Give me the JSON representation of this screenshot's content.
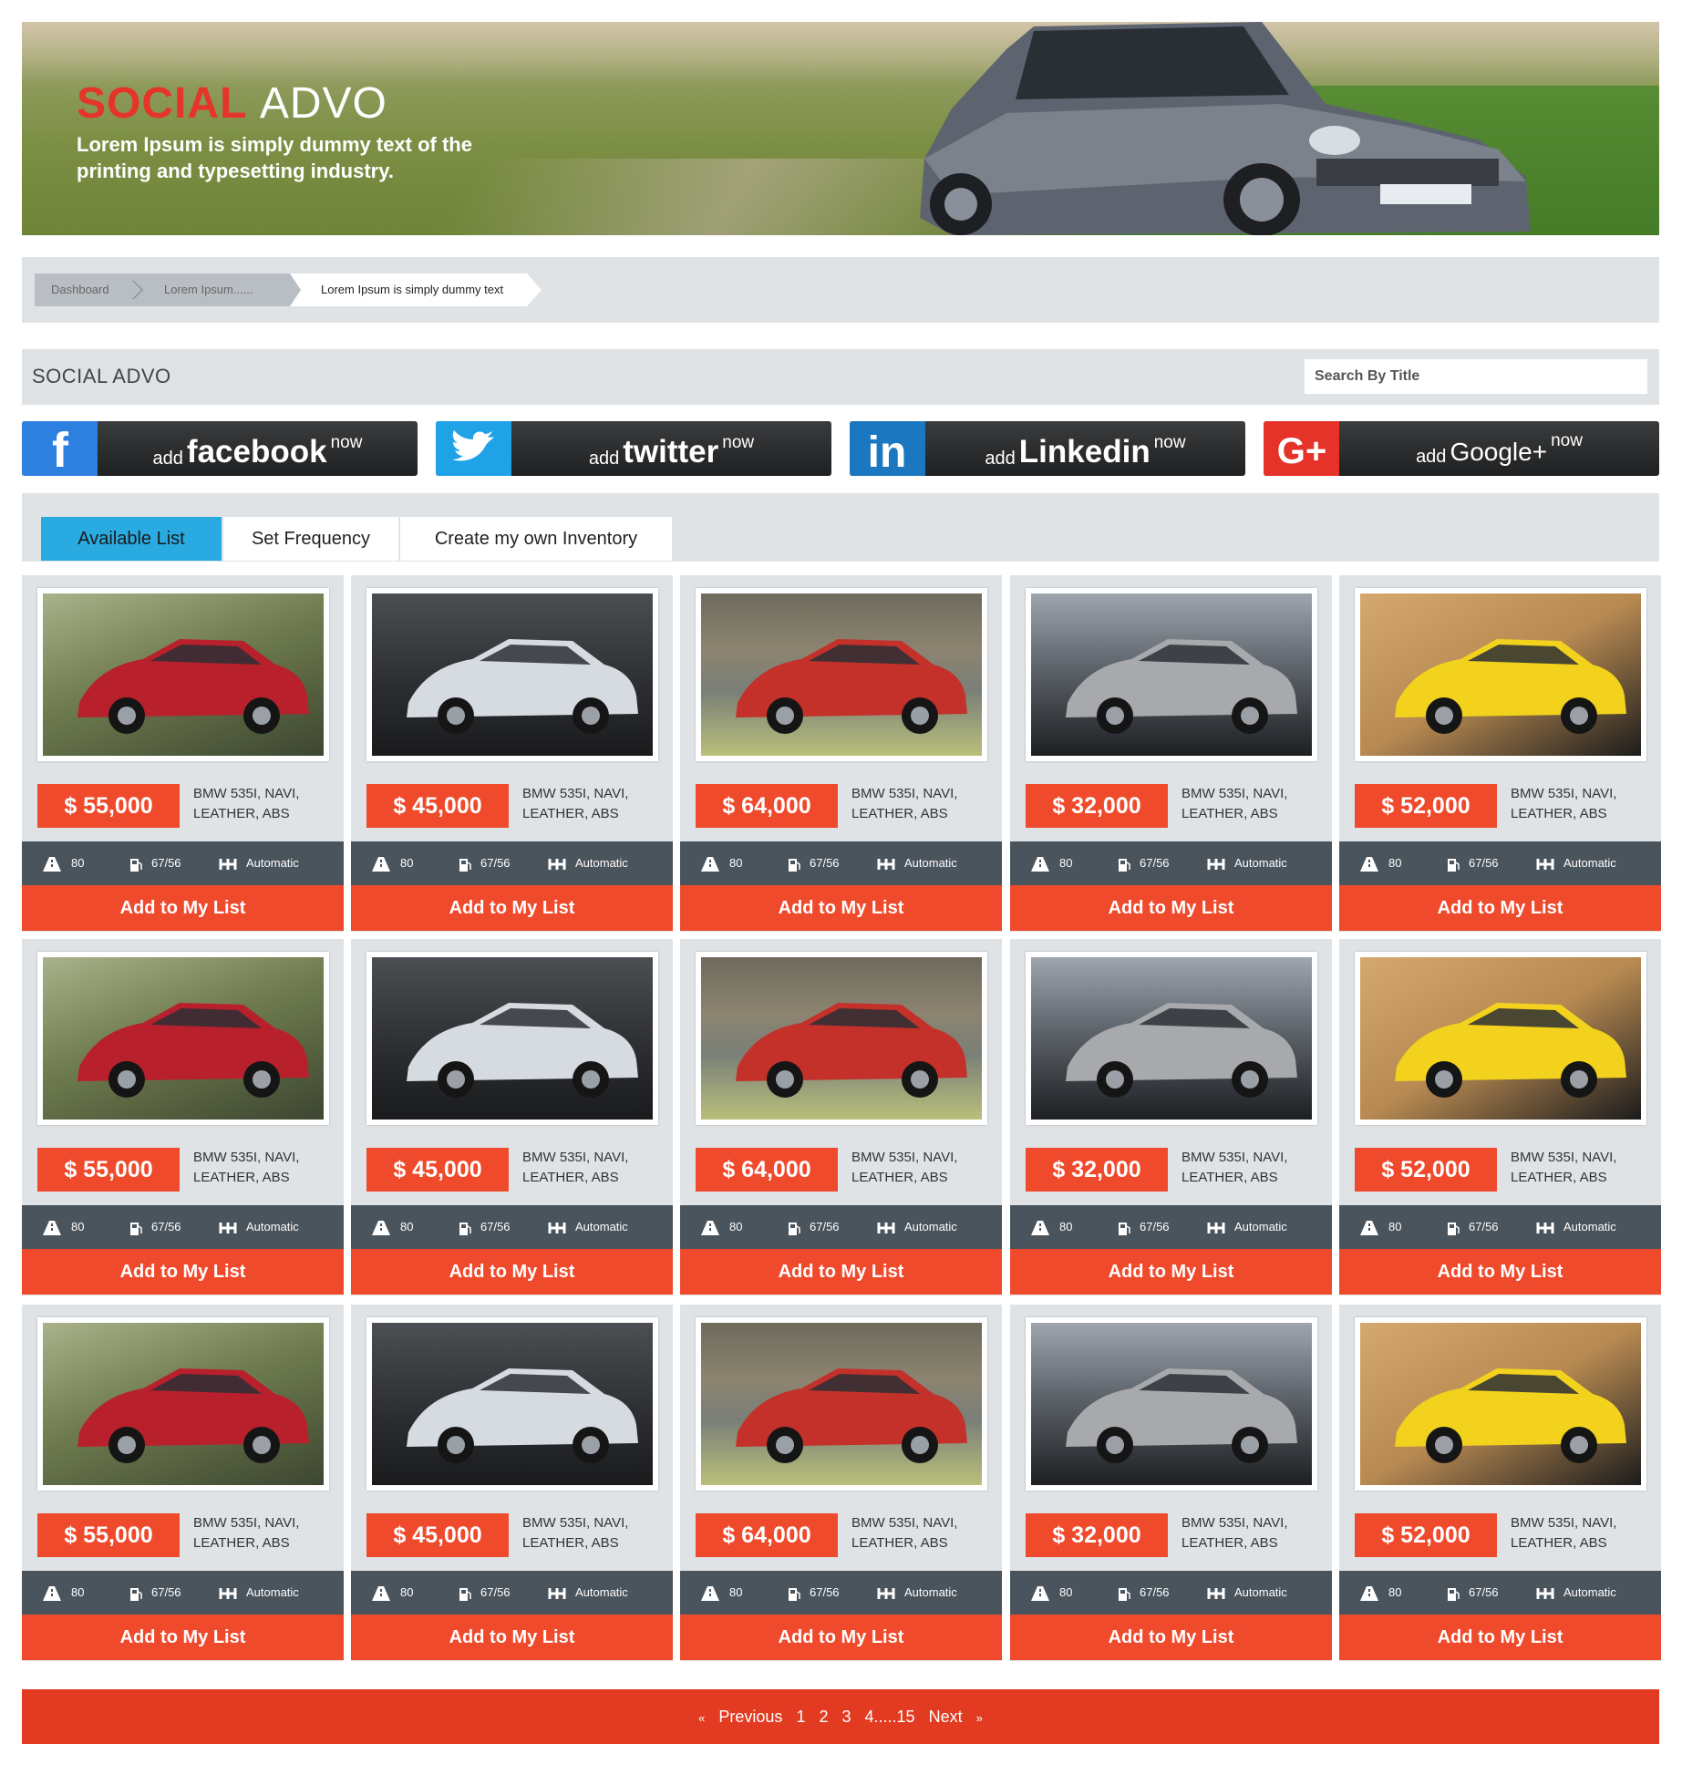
{
  "banner": {
    "brand_red": "SOCIAL",
    "brand_white": "ADVO",
    "tagline": "Lorem Ipsum is simply dummy text of the printing and typesetting industry."
  },
  "breadcrumb": {
    "items": [
      "Dashboard",
      "Lorem Ipsum......",
      "Lorem Ipsum is simply dummy text"
    ]
  },
  "header": {
    "title": "SOCIAL ADVO",
    "search_placeholder": "Search By Title"
  },
  "social": [
    {
      "prefix": "add",
      "name": "facebook",
      "suffix": "now",
      "icon": "facebook-icon",
      "color": "#2d7fe0"
    },
    {
      "prefix": "add",
      "name": "twitter",
      "suffix": "now",
      "icon": "twitter-icon",
      "color": "#1fa3e6"
    },
    {
      "prefix": "add",
      "name": "Linkedin",
      "suffix": "now",
      "icon": "linkedin-icon",
      "color": "#1b78c0"
    },
    {
      "prefix": "add",
      "name": "Google+",
      "suffix": "now",
      "icon": "google-plus-icon",
      "color": "#e5332a"
    }
  ],
  "tabs": [
    {
      "label": "Available List",
      "active": true
    },
    {
      "label": "Set Frequency",
      "active": false
    },
    {
      "label": "Create my own Inventory",
      "active": false
    }
  ],
  "listings": {
    "desc_line1": "BMW 535I, NAVI,",
    "desc_line2": "LEATHER, ABS",
    "spec_speed": "80",
    "spec_fuel": "67/56",
    "spec_transmission": "Automatic",
    "add_label": "Add to My List",
    "spec_icons": [
      "road-icon",
      "fuel-icon",
      "gearbox-icon"
    ],
    "cars": [
      {
        "price": "$ 55,000",
        "image": "red-sedan-photo",
        "body": "#b8202c"
      },
      {
        "price": "$ 45,000",
        "image": "silver-convertible-photo",
        "body": "#d6dbe2"
      },
      {
        "price": "$ 64,000",
        "image": "red-coupe-photo",
        "body": "#c4302a"
      },
      {
        "price": "$ 32,000",
        "image": "silver-mercedes-photo",
        "body": "#a7a9ac"
      },
      {
        "price": "$ 52,000",
        "image": "yellow-lamborghini-photo",
        "body": "#f2d21c"
      }
    ],
    "rows": 3
  },
  "pagination": {
    "prev_icon": "«",
    "previous": "Previous",
    "pages": [
      "1",
      "2",
      "3",
      "4.....15"
    ],
    "next": "Next",
    "next_icon": "»"
  },
  "colors": {
    "accent_red": "#f04a2c",
    "tab_active": "#29abe2",
    "panel_gray": "#dfe3e6",
    "spec_bar": "#4a545c"
  }
}
